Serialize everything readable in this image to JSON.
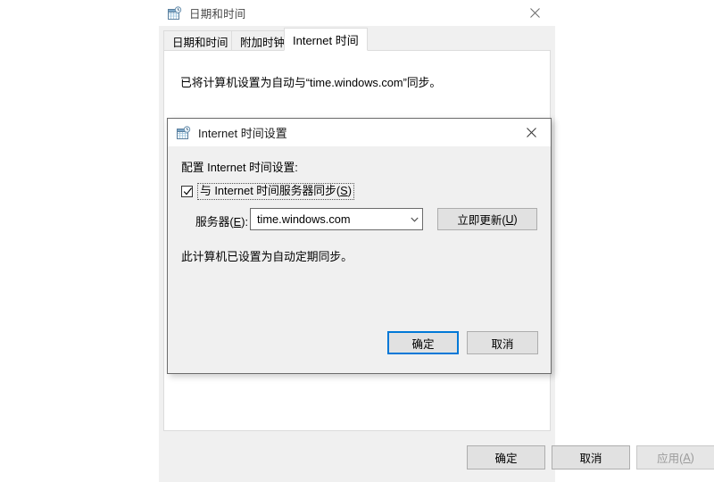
{
  "outer_window": {
    "title": "日期和时间",
    "icon": "date-time-calendar-clock-icon",
    "close_glyph": "✕",
    "tabs": [
      {
        "label": "日期和时间",
        "active": false
      },
      {
        "label": "附加时钟",
        "active": false
      },
      {
        "label": "Internet 时间",
        "active": true
      }
    ],
    "panel": {
      "sync_status_text": "已将计算机设置为自动与“time.windows.com”同步。"
    },
    "buttons": {
      "ok": "确定",
      "cancel": "取消",
      "apply_prefix": "应用(",
      "apply_accel": "A",
      "apply_suffix": ")",
      "apply_disabled": true
    }
  },
  "inner_dialog": {
    "title": "Internet 时间设置",
    "icon": "date-time-calendar-clock-icon",
    "close_glyph": "✕",
    "config_label": "配置 Internet 时间设置:",
    "sync_checkbox": {
      "checked": true,
      "label_prefix": "与 Internet 时间服务器同步(",
      "label_accel": "S",
      "label_suffix": ")"
    },
    "server_row": {
      "label_prefix": "服务器(",
      "label_accel": "E",
      "label_suffix": "):",
      "value": "time.windows.com",
      "arrow_icon": "chevron-down-icon",
      "update_button_prefix": "立即更新(",
      "update_button_accel": "U",
      "update_button_suffix": ")"
    },
    "periodic_status": "此计算机已设置为自动定期同步。",
    "buttons": {
      "ok": "确定",
      "cancel": "取消",
      "ok_focused": true
    }
  },
  "colors": {
    "accent": "#0078d7",
    "window_bg": "#f0f0f0",
    "panel_bg": "#ffffff",
    "button_bg": "#e1e1e1",
    "border": "#adadad",
    "disabled_text": "#9a9a9a",
    "title_text": "#4a4a4a"
  }
}
